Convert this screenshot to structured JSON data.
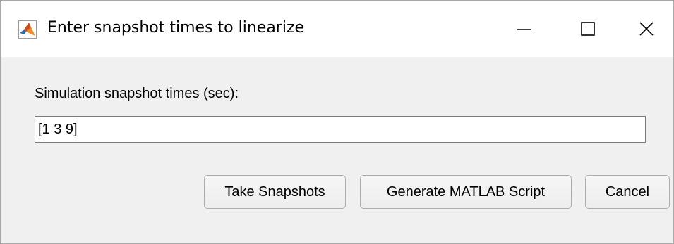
{
  "window": {
    "title": "Enter snapshot times to linearize",
    "icon": "matlab-logo-icon",
    "controls": {
      "minimize_icon": "minimize-icon",
      "maximize_icon": "maximize-icon",
      "close_icon": "close-icon"
    }
  },
  "form": {
    "label": "Simulation snapshot times (sec):",
    "input_value": "[1 3 9]"
  },
  "buttons": {
    "take_snapshots": "Take Snapshots",
    "generate_script": "Generate MATLAB Script",
    "cancel": "Cancel"
  },
  "colors": {
    "titlebar_bg": "#ffffff",
    "dialog_bg": "#f0f0f0",
    "button_border": "#adadad",
    "input_border": "#7a7a7a",
    "logo_orange": "#e16a1a",
    "logo_blue": "#2a6db5"
  }
}
